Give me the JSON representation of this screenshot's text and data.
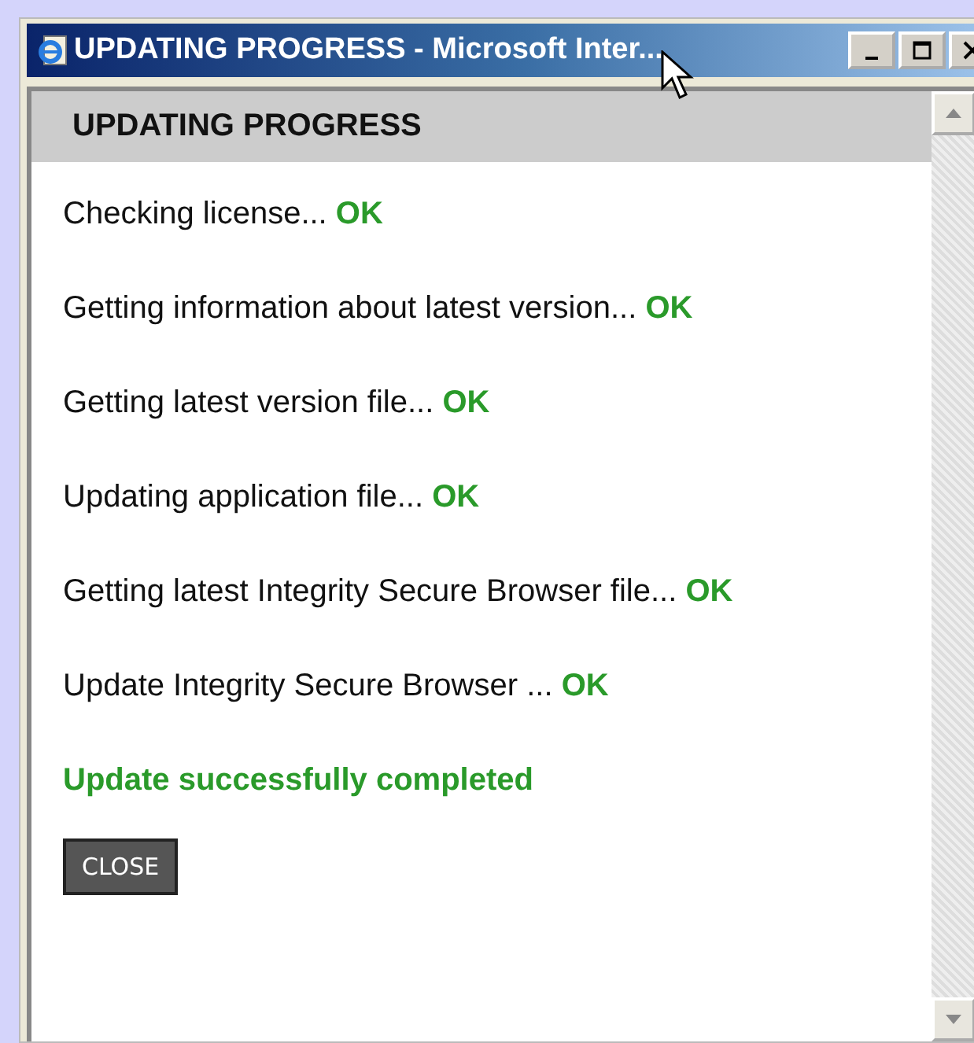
{
  "window": {
    "title": "UPDATING PROGRESS - Microsoft Inter..."
  },
  "header": "UPDATING PROGRESS",
  "steps": [
    {
      "text": "Checking license...",
      "status": "OK"
    },
    {
      "text": "Getting information about latest version...",
      "status": "OK"
    },
    {
      "text": "Getting latest version file...",
      "status": "OK"
    },
    {
      "text": "Updating application file...",
      "status": "OK"
    },
    {
      "text": "Getting latest Integrity Secure Browser file...",
      "status": "OK"
    },
    {
      "text": "Update Integrity Secure Browser ...",
      "status": "OK"
    }
  ],
  "result": "Update successfully completed",
  "buttons": [
    "CLOSE"
  ]
}
